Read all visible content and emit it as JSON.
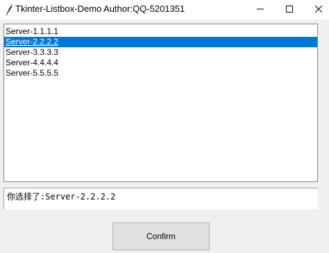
{
  "window": {
    "title": "Tkinter-Listbox-Demo  Author:QQ-5201351",
    "icon": "feather-icon",
    "controls": [
      "minimize-icon",
      "maximize-icon",
      "close-icon"
    ]
  },
  "listbox": {
    "items": [
      {
        "label": "Server-1.1.1.1",
        "selected": false
      },
      {
        "label": "Server-2.2.2.2",
        "selected": true
      },
      {
        "label": "Server-3.3.3.3",
        "selected": false
      },
      {
        "label": "Server-4.4.4.4",
        "selected": false
      },
      {
        "label": "Server-5.5.5.5",
        "selected": false
      }
    ],
    "selection_color": "#0078d7"
  },
  "result": {
    "text": "你选择了:Server-2.2.2.2"
  },
  "confirm_button": {
    "label": "Confirm"
  }
}
